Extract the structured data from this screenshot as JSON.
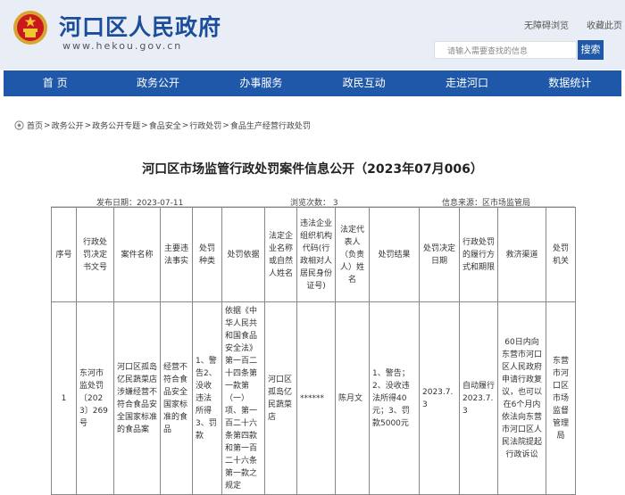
{
  "header": {
    "site_title": "河口区人民政府",
    "site_url": "www.hekou.gov.cn",
    "barrier_free": "无障碍浏览",
    "favorite": "收藏此页",
    "search_placeholder": "请输入需要查找的信息",
    "search_button": "搜索"
  },
  "nav": [
    {
      "label": "首 页"
    },
    {
      "label": "政务公开"
    },
    {
      "label": "办事服务"
    },
    {
      "label": "政民互动"
    },
    {
      "label": "走进河口"
    },
    {
      "label": "数据统计"
    }
  ],
  "breadcrumb": [
    "首页",
    "政务公开",
    "政务公开专题",
    "食品安全",
    "行政处罚",
    "食品生产经营行政处罚"
  ],
  "article": {
    "title": "河口区市场监管行政处罚案件信息公开（2023年07月006）",
    "publish_date": "发布日期：2023-07-11",
    "views": "浏览次数：  3",
    "source": "信息来源：区市场监管局"
  },
  "table": {
    "headers": [
      "序号",
      "行政处罚决定书文号",
      "案件名称",
      "主要违法事实",
      "处罚种类",
      "处罚依据",
      "法定企业名称或自然人姓名",
      "违法企业组织机构代码(行政相对人居民身份证号)",
      "法定代表人（负责人）姓名",
      "处罚结果",
      "处罚决定日期",
      "行政处罚的履行方式和期限",
      "救济渠道",
      "处罚机关"
    ],
    "row": [
      "1",
      "东河市监处罚〔2023〕269号",
      "河口区孤岛亿民蔬菜店涉嫌经营不符合食品安全国家标准的食品案",
      "经营不符合食品安全国家标准的食品",
      "1、警告2、没收违法所得3、罚款",
      "依据《中华人民共和国食品安全法》第一百二十四条第一款第（一）项、第一百二十六条第四款和第一百二十六条第一款之规定",
      "河口区孤岛亿民蔬菜店",
      "******",
      "陈月文",
      "1、警告；2、没收违法所得40元；3、罚款5000元",
      "2023.7.3",
      "自动履行2023.7.3",
      "60日内向东营市河口区人民政府申请行政复议，也可以在6个月内依法向东营市河口区人民法院提起行政诉讼",
      "东营市河口区市场监督管理局"
    ]
  },
  "colors": {
    "brand_blue": "#1f58a8",
    "header_bg": "#e9eef6"
  }
}
